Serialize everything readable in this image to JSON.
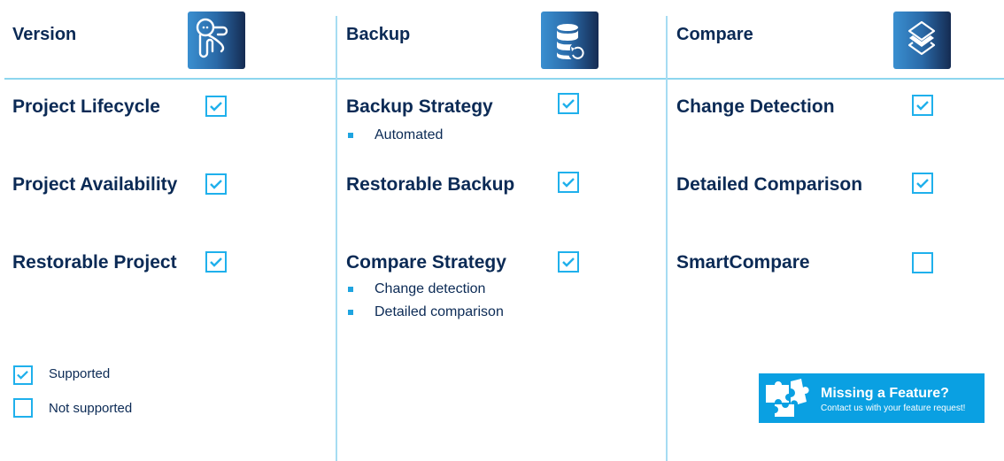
{
  "columns": [
    {
      "title": "Version",
      "icon": "octopus-mascot-icon",
      "features": [
        {
          "label": "Project Lifecycle",
          "supported": true,
          "bullets": []
        },
        {
          "label": "Project Availability",
          "supported": true,
          "bullets": []
        },
        {
          "label": "Restorable Project",
          "supported": true,
          "bullets": []
        }
      ]
    },
    {
      "title": "Backup",
      "icon": "database-restore-icon",
      "features": [
        {
          "label": "Backup Strategy",
          "supported": true,
          "bullets": [
            "Automated"
          ]
        },
        {
          "label": "Restorable Backup",
          "supported": true,
          "bullets": []
        },
        {
          "label": "Compare Strategy",
          "supported": true,
          "bullets": [
            "Change detection",
            "Detailed comparison"
          ]
        }
      ]
    },
    {
      "title": "Compare",
      "icon": "layers-icon",
      "features": [
        {
          "label": "Change Detection",
          "supported": true,
          "bullets": []
        },
        {
          "label": "Detailed Comparison",
          "supported": true,
          "bullets": []
        },
        {
          "label": "SmartCompare",
          "supported": false,
          "bullets": []
        }
      ]
    }
  ],
  "legend": {
    "supported": "Supported",
    "not_supported": "Not supported"
  },
  "promo": {
    "icon": "puzzle-icon",
    "title": "Missing a Feature?",
    "subtitle": "Contact us with your feature request!"
  },
  "colors": {
    "accent": "#1fb0ec",
    "text": "#0b2a55",
    "divider": "#8dd6ee",
    "promo_bg": "#0aa0e2"
  }
}
